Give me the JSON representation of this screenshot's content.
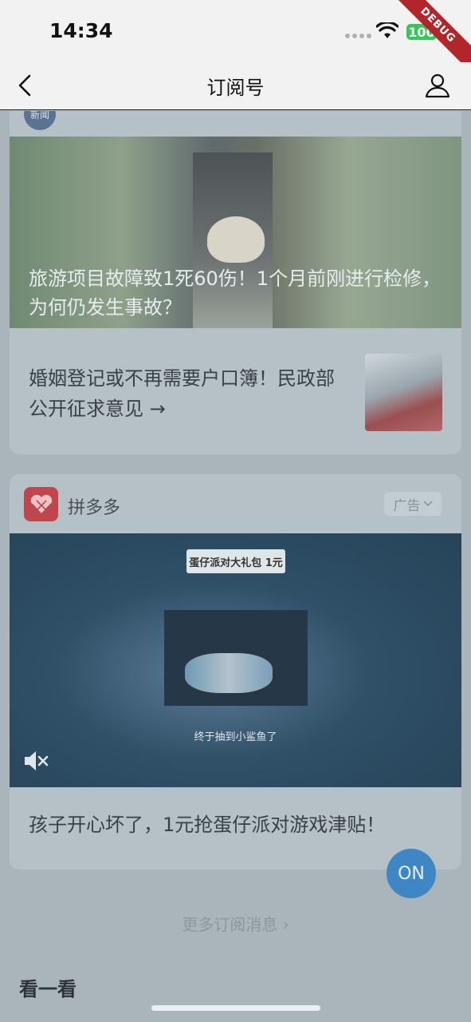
{
  "status": {
    "time": "14:34",
    "battery": "100",
    "debug_label": "DEBUG"
  },
  "nav": {
    "title": "订阅号"
  },
  "news_card": {
    "source_avatar": "新闻",
    "hero_title": "旅游项目故障致1死60伤！1个月前刚进行检修，为何仍发生事故？",
    "item_title": "婚姻登记或不再需要户口簿！民政部公开征求意见 →"
  },
  "ad_card": {
    "advertiser": "拼多多",
    "ad_label": "广告",
    "video_banner": "蛋仔派对大礼包 1元",
    "video_caption": "终于抽到小鲨鱼了",
    "ad_text": "孩子开心坏了，1元抢蛋仔派对游戏津贴！"
  },
  "on_button": "ON",
  "more_link": "更多订阅消息 ›",
  "section_title": "看一看",
  "colors": {
    "accent": "#3f86c4",
    "pdd_brand": "#c0464d",
    "debug": "#b2262b",
    "battery": "#35c759"
  }
}
